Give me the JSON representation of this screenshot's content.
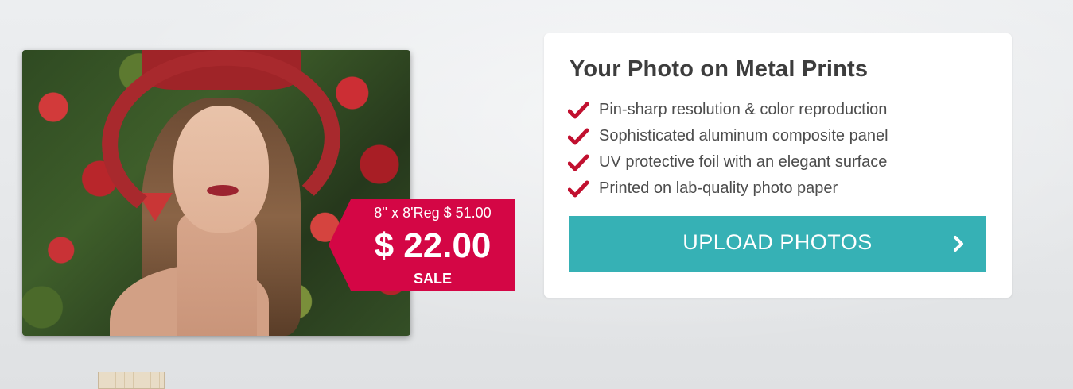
{
  "product": {
    "title": "Your Photo on Metal Prints",
    "features": [
      "Pin-sharp resolution & color reproduction",
      "Sophisticated aluminum composite panel",
      "UV protective foil with an elegant surface",
      "Printed on lab-quality photo paper"
    ],
    "upload_button_label": "UPLOAD PHOTOS"
  },
  "price_tag": {
    "size_and_regular": "8'' x 8'Reg $ 51.00",
    "price": "$ 22.00",
    "badge": "SALE"
  },
  "colors": {
    "accent_teal": "#36b1b5",
    "sale_red": "#d40645",
    "check_red": "#c1102f"
  },
  "icons": {
    "feature_check": "checkmark-icon",
    "button_arrow": "chevron-right-icon"
  }
}
